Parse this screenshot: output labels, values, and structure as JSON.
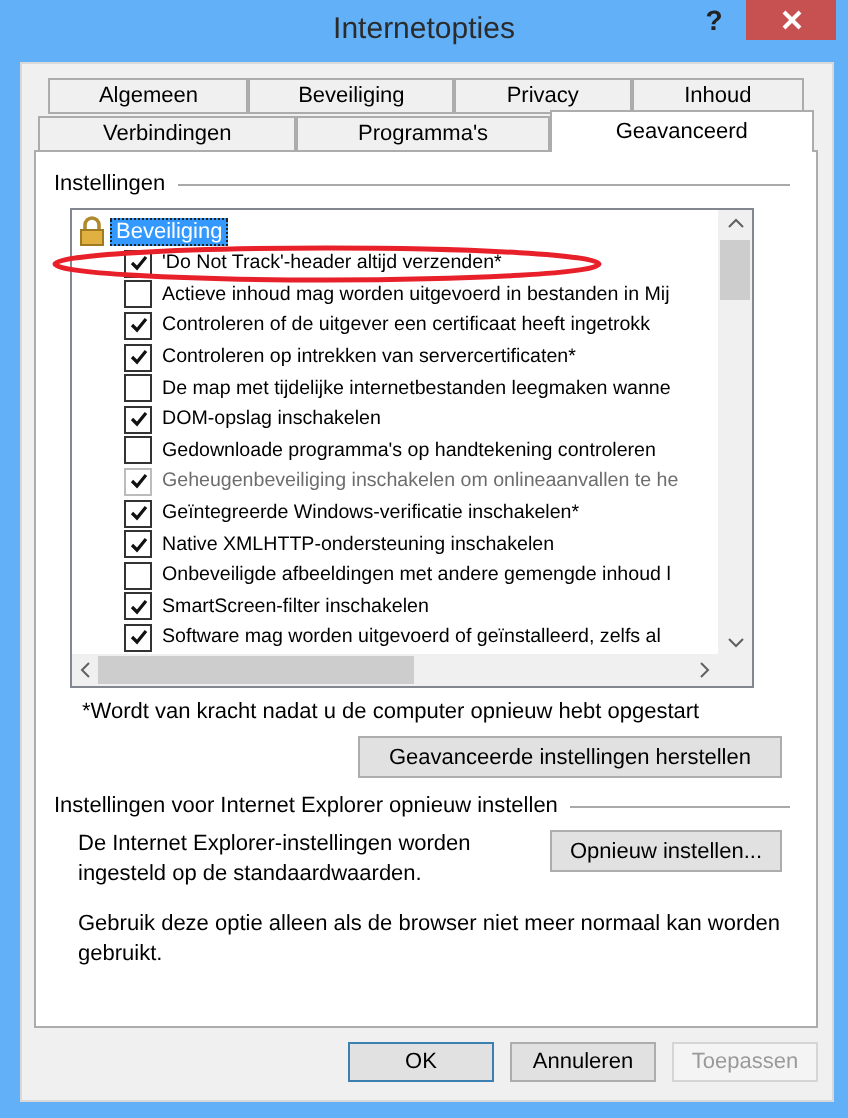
{
  "window": {
    "title": "Internetopties",
    "help_label": "?"
  },
  "tab_rows": [
    {
      "tabs": [
        {
          "label": "Algemeen",
          "selected": false
        },
        {
          "label": "Beveiliging",
          "selected": false
        },
        {
          "label": "Privacy",
          "selected": false
        },
        {
          "label": "Inhoud",
          "selected": false
        }
      ]
    },
    {
      "tabs": [
        {
          "label": "Verbindingen",
          "selected": false
        },
        {
          "label": "Programma's",
          "selected": false
        },
        {
          "label": "Geavanceerd",
          "selected": true
        }
      ]
    }
  ],
  "settings_group": {
    "label": "Instellingen",
    "tree": [
      {
        "label": "Beveiliging",
        "selected": true,
        "children": [
          {
            "label": "'Do Not Track'-header altijd verzenden*",
            "checked": true,
            "disabled": false
          },
          {
            "label": "Actieve inhoud mag worden uitgevoerd in bestanden in Mij",
            "checked": false,
            "disabled": false
          },
          {
            "label": "Controleren of de uitgever een certificaat heeft ingetrokk",
            "checked": true,
            "disabled": false
          },
          {
            "label": "Controleren op intrekken van servercertificaten*",
            "checked": true,
            "disabled": false
          },
          {
            "label": "De map met tijdelijke internetbestanden leegmaken wanne",
            "checked": false,
            "disabled": false
          },
          {
            "label": "DOM-opslag inschakelen",
            "checked": true,
            "disabled": false
          },
          {
            "label": "Gedownloade programma's op handtekening controleren",
            "checked": false,
            "disabled": false
          },
          {
            "label": "Geheugenbeveiliging inschakelen om onlineaanvallen te he",
            "checked": true,
            "disabled": true
          },
          {
            "label": "Geïntegreerde Windows-verificatie inschakelen*",
            "checked": true,
            "disabled": false
          },
          {
            "label": "Native XMLHTTP-ondersteuning inschakelen",
            "checked": true,
            "disabled": false
          },
          {
            "label": "Onbeveiligde afbeeldingen met andere gemengde inhoud l",
            "checked": false,
            "disabled": false
          },
          {
            "label": "SmartScreen-filter inschakelen",
            "checked": true,
            "disabled": false
          },
          {
            "label": "Software mag worden uitgevoerd of geïnstalleerd, zelfs al",
            "checked": true,
            "disabled": false
          }
        ]
      }
    ],
    "annotations": [
      {
        "kind": "ellipse"
      }
    ],
    "footnote": "*Wordt van kracht nadat u de computer opnieuw hebt opgestart",
    "restore_button": "Geavanceerde instellingen herstellen"
  },
  "reset_group": {
    "label": "Instellingen voor Internet Explorer opnieuw instellen",
    "description": "De Internet Explorer-instellingen worden ingesteld op de standaardwaarden.",
    "button": "Opnieuw instellen...",
    "note": "Gebruik deze optie alleen als de browser niet meer normaal kan worden gebruikt."
  },
  "buttons": [
    {
      "label": "OK",
      "default": true,
      "disabled": false
    },
    {
      "label": "Annuleren",
      "default": false,
      "disabled": false
    },
    {
      "label": "Toepassen",
      "default": false,
      "disabled": true
    }
  ]
}
